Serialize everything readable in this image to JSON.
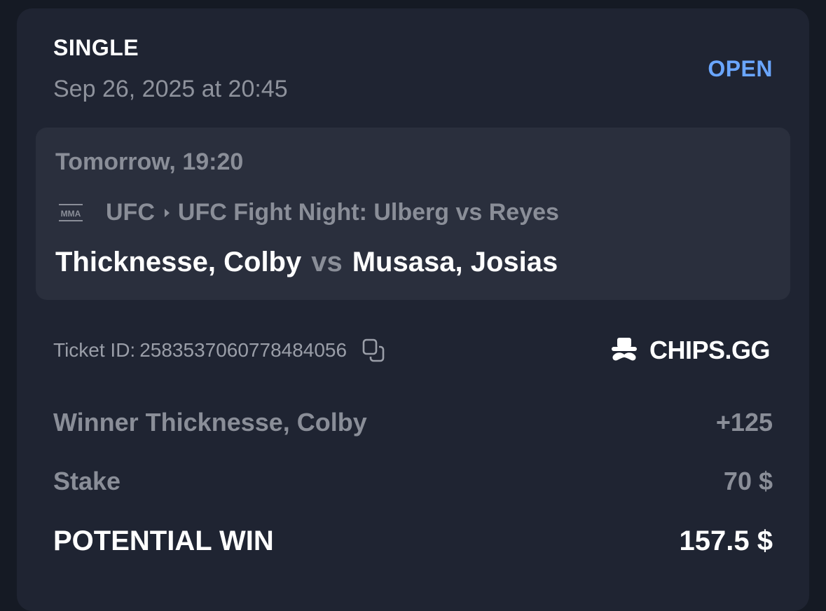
{
  "bet": {
    "type": "SINGLE",
    "placed_at": "Sep 26, 2025 at 20:45",
    "status": "OPEN"
  },
  "event": {
    "time": "Tomorrow, 19:20",
    "sport_icon_label": "MMA",
    "breadcrumb": [
      "UFC",
      "UFC Fight Night: Ulberg vs Reyes"
    ],
    "home": "Thicknesse, Colby",
    "vs": "vs",
    "away": "Musasa, Josias"
  },
  "ticket": {
    "label": "Ticket ID:",
    "id": "2583537060778484056"
  },
  "brand": {
    "name": "CHIPS.GG"
  },
  "selection": {
    "label": "Winner Thicknesse, Colby",
    "odds": "+125"
  },
  "stake": {
    "label": "Stake",
    "value": "70 $"
  },
  "potential_win": {
    "label": "POTENTIAL WIN",
    "value": "157.5 $"
  },
  "colors": {
    "background": "#151a24",
    "card": "#1f2432",
    "event_box": "#2a2f3d",
    "status_open": "#6aa6ff",
    "muted_text": "#8a8e98"
  }
}
